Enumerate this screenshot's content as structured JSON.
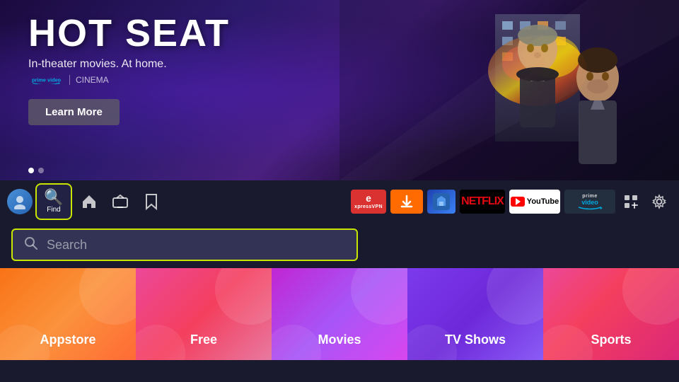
{
  "hero": {
    "title": "HOT SEAT",
    "subtitle": "In-theater movies. At home.",
    "brand": "prime video",
    "brand_separator": "|",
    "cinema_label": "CINEMA",
    "learn_more_label": "Learn More",
    "dots": [
      true,
      false
    ]
  },
  "navbar": {
    "find_label": "Find",
    "icons": {
      "home": "⌂",
      "tv": "📺",
      "bookmark": "🔖"
    }
  },
  "apps": [
    {
      "id": "expressvpn",
      "label": "ExpressVPN"
    },
    {
      "id": "downloader",
      "label": "Downloader"
    },
    {
      "id": "filebrowser",
      "label": "File Browser"
    },
    {
      "id": "netflix",
      "label": "NETFLIX"
    },
    {
      "id": "youtube",
      "label": "YouTube"
    },
    {
      "id": "primevideo",
      "label": "prime video"
    }
  ],
  "search": {
    "placeholder": "Search",
    "icon": "🔍"
  },
  "categories": [
    {
      "id": "appstore",
      "label": "Appstore",
      "color": "#f97316"
    },
    {
      "id": "free",
      "label": "Free",
      "color": "#ec4899"
    },
    {
      "id": "movies",
      "label": "Movies",
      "color": "#c026d3"
    },
    {
      "id": "tvshows",
      "label": "TV Shows",
      "color": "#7c3aed"
    },
    {
      "id": "sports",
      "label": "Sports",
      "color": "#ec4899"
    }
  ]
}
